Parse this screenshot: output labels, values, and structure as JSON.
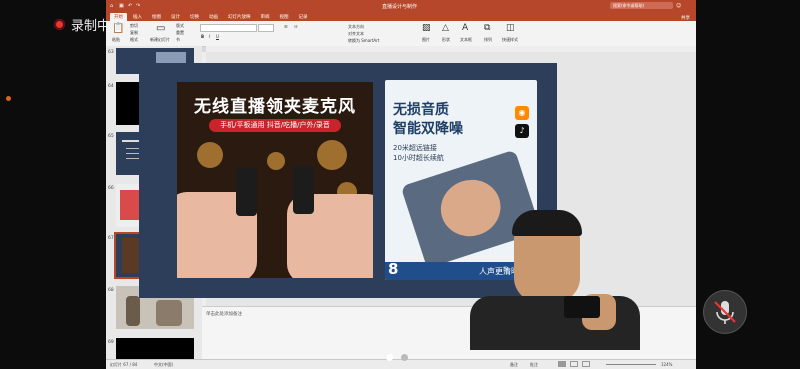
{
  "overlay": {
    "recording_label": "录制中"
  },
  "window": {
    "doc_title": "直播设计与制作",
    "search_placeholder": "搜索(命令或帮助)",
    "share_label": "共享",
    "tabs": [
      "开始",
      "插入",
      "绘图",
      "设计",
      "切换",
      "动画",
      "幻灯片放映",
      "审阅",
      "视图",
      "记录"
    ],
    "active_tab": "开始"
  },
  "ribbon": {
    "paste": "粘贴",
    "cut": "剪切",
    "copy": "复制",
    "format": "格式",
    "new_slide": "新建幻灯片",
    "reset": "重置",
    "layout": "版式",
    "section": "节",
    "picture": "图片",
    "shape": "形状",
    "textbox": "文本框",
    "arrange": "排列",
    "quick_style": "快速样式",
    "text_direction": "文本方向",
    "align_text": "对齐文本",
    "convert_smartart": "转换为 SmartArt"
  },
  "thumbnails": [
    {
      "num": "63",
      "kind": "collage"
    },
    {
      "num": "64",
      "kind": "black"
    },
    {
      "num": "65",
      "kind": "text"
    },
    {
      "num": "66",
      "kind": "classroom"
    },
    {
      "num": "67",
      "kind": "current"
    },
    {
      "num": "68",
      "kind": "photo"
    },
    {
      "num": "69",
      "kind": "black"
    }
  ],
  "slide": {
    "left_title": "无线直播领夹麦克风",
    "left_subtitle": "手机/平板通用 抖音/吃播/户外/录音",
    "right_line1": "无损音质",
    "right_line2": "智能双降噪",
    "right_line3": "20米超远链接",
    "right_line4": "10小时超长续航",
    "bottom_left": "8",
    "bottom_right": "人声更清晰",
    "bottom_tag": "雷"
  },
  "notes": {
    "placeholder": "单击此处添加备注"
  },
  "status": {
    "slide_info": "幻灯片 67 / 84",
    "language": "中文(中国)",
    "notes_btn": "备注",
    "comments_btn": "批注",
    "zoom": "124%"
  },
  "colors": {
    "ppt_accent": "#b7472a",
    "slide_bg": "#2d3e5b",
    "record_dot": "#ee3333"
  }
}
